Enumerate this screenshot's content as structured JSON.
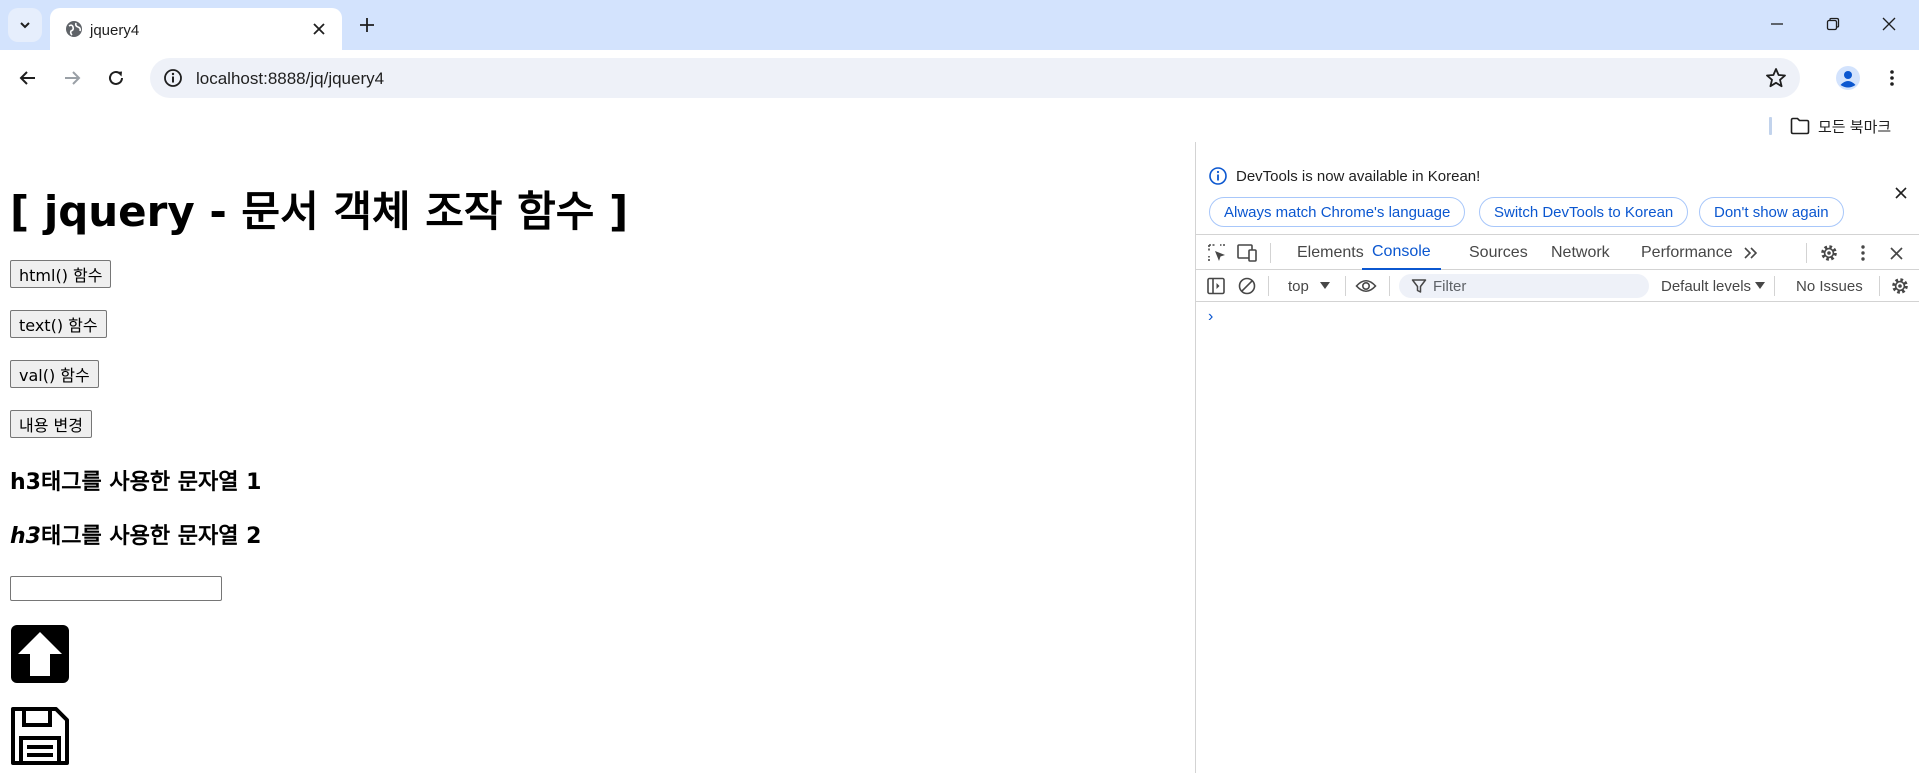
{
  "browser": {
    "tab_title": "jquery4",
    "url": "localhost:8888/jq/jquery4",
    "bookmarks_folder_label": "모든 북마크"
  },
  "page": {
    "heading": "[ jquery - 문서 객체 조작 함수 ]",
    "buttons": {
      "html_btn": "html() 함수",
      "text_btn": "text() 함수",
      "val_btn": "val() 함수",
      "change_btn": "내용 변경"
    },
    "h3_line1": "h3태그를 사용한 문자열 1",
    "h3_line2_italic": "h3",
    "h3_line2_rest": "태그를 사용한 문자열 2",
    "text_input_value": ""
  },
  "devtools": {
    "infobar": {
      "message": "DevTools is now available in Korean!",
      "match_btn": "Always match Chrome's language",
      "switch_btn": "Switch DevTools to Korean",
      "dismiss_btn": "Don't show again"
    },
    "tabs": [
      "Elements",
      "Console",
      "Sources",
      "Network",
      "Performance"
    ],
    "active_tab": "Console",
    "console": {
      "context": "top",
      "filter_placeholder": "Filter",
      "levels": "Default levels",
      "issues": "No Issues",
      "prompt": "›"
    }
  },
  "colors": {
    "tabstrip_bg": "#d3e3fd",
    "omnibox_bg": "#eef1f8",
    "accent_blue": "#0b57d0"
  },
  "icons": {
    "tab_search": "chevron-down-icon",
    "favicon": "globe-icon",
    "new_tab": "plus-icon",
    "back": "arrow-left-icon",
    "forward": "arrow-right-icon",
    "reload": "reload-icon",
    "site_info": "info-icon",
    "bookmark_star": "star-icon",
    "profile": "profile-icon",
    "menu": "kebab-menu-icon",
    "bookmarks_folder": "folder-icon",
    "up_arrow_image": "up-arrow-icon",
    "save_image": "floppy-disk-icon"
  }
}
